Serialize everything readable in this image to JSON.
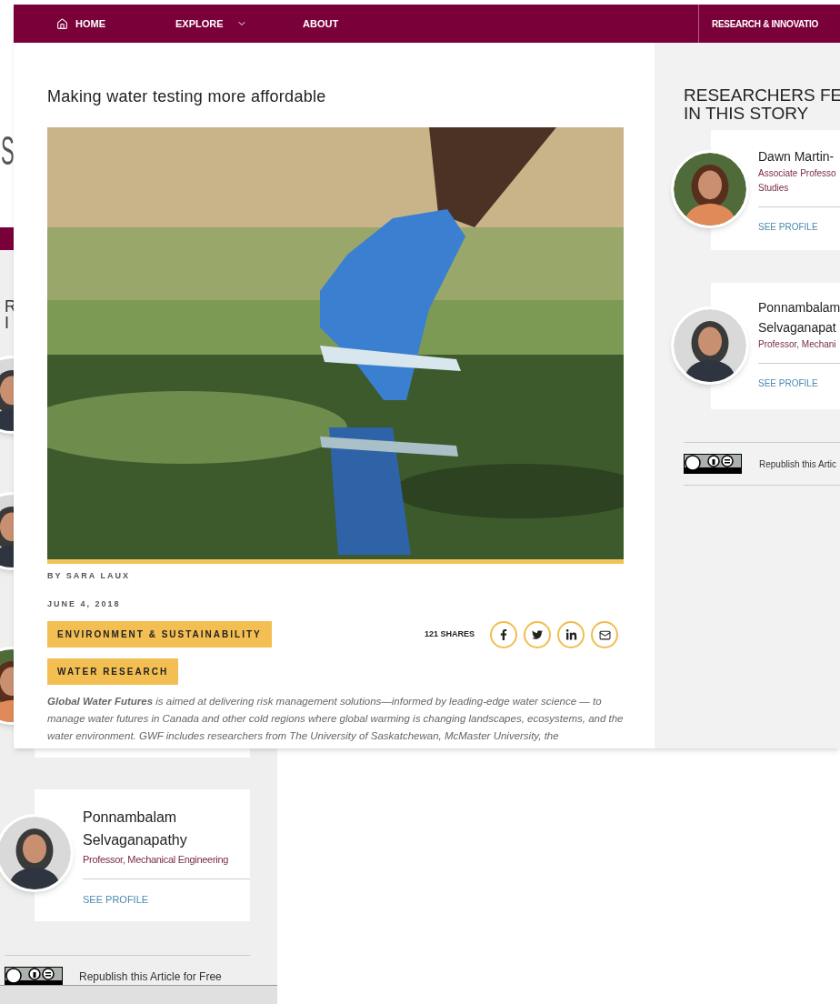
{
  "back_page": {
    "heading_fragment": "S",
    "sidebar_heading_fragments": [
      "R",
      "I"
    ],
    "researcher": {
      "name": "Ponnambalam Selvaganapathy",
      "title": "Professor, Mechanical Engineering",
      "link": "SEE PROFILE"
    },
    "republish": "Republish this Article for Free"
  },
  "nav": {
    "items": [
      {
        "label": "HOME",
        "kind": "home"
      },
      {
        "label": "EXPLORE",
        "kind": "dropdown"
      },
      {
        "label": "ABOUT",
        "kind": "plain"
      }
    ],
    "right_item": "RESEARCH & INNOVATIO"
  },
  "article": {
    "title": "Making water testing more affordable",
    "byline": "BY SARA LAUX",
    "date": "JUNE 4, 2018",
    "tags": [
      "ENVIRONMENT & SUSTAINABILITY",
      "WATER RESEARCH"
    ],
    "shares": "121 SHARES",
    "share_buttons": [
      {
        "kind": "facebook"
      },
      {
        "kind": "twitter"
      },
      {
        "kind": "linkedin"
      },
      {
        "kind": "email"
      }
    ],
    "body": "**Global Water Futures** is aimed at delivering risk management solutions—informed by leading-edge water science — to manage water futures in Canada and other cold regions where global warming is changing landscapes, ecosystems, and the water environment. GWF includes researchers from The University of Saskatchewan, McMaster University, the"
  },
  "sidebar": {
    "heading_lines": [
      "RESEARCHERS FE",
      "IN THIS STORY"
    ],
    "researchers": [
      {
        "name_lines": [
          "Dawn Martin-"
        ],
        "title_lines": [
          "Associate Professo",
          "Studies"
        ],
        "link": "SEE PROFILE"
      },
      {
        "name_lines": [
          "Ponnambalam",
          "Selvaganapat"
        ],
        "title_lines": [
          "Professor, Mechani"
        ],
        "link": "SEE PROFILE"
      }
    ],
    "republish": "Republish this Artic"
  }
}
